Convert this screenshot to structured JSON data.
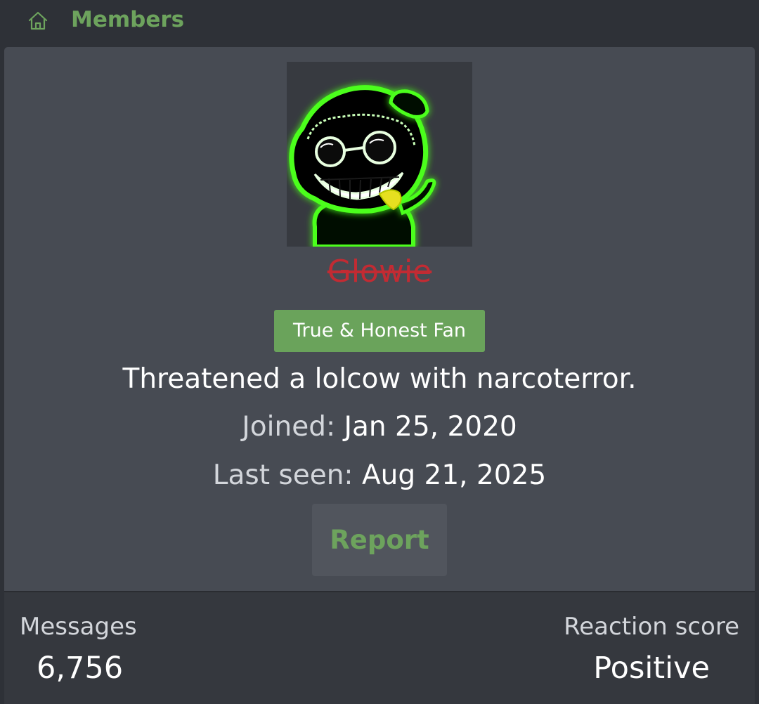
{
  "breadcrumb": {
    "home_icon": "home-icon",
    "label": "Members"
  },
  "profile": {
    "avatar_description_icon": "glowing-green-smiling-character-avatar",
    "username": "Glowie",
    "username_color": "#c22b33",
    "user_title_badge": "True & Honest Fan",
    "badge_color": "#6aa35b",
    "custom_title": "Threatened a lolcow with narcoterror.",
    "joined_label": "Joined:",
    "joined_value": "Jan 25, 2020",
    "last_seen_label": "Last seen:",
    "last_seen_value": "Aug 21, 2025",
    "report_label": "Report"
  },
  "stats": {
    "messages_label": "Messages",
    "messages_value": "6,756",
    "reaction_label": "Reaction score",
    "reaction_value": "Positive"
  },
  "colors": {
    "accent_green": "#6da35d",
    "card_bg": "#474b53",
    "page_bg": "#2e3137"
  }
}
